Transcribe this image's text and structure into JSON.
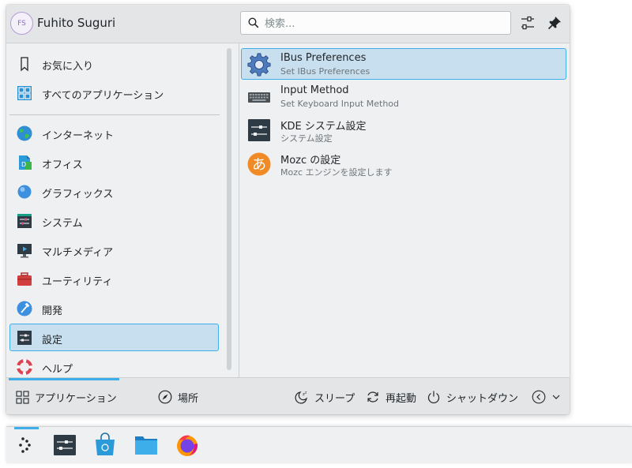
{
  "header": {
    "avatar_initials": "FS",
    "username": "Fuhito Suguri",
    "search_placeholder": "検索...",
    "configure_icon": "sliders-icon",
    "pin_icon": "pin-icon"
  },
  "sidebar": {
    "items": [
      {
        "label": "お気に入り",
        "icon": "bookmark-icon"
      },
      {
        "label": "すべてのアプリケーション",
        "icon": "grid-icon"
      },
      {
        "label": "インターネット",
        "icon": "globe-icon"
      },
      {
        "label": "オフィス",
        "icon": "office-icon"
      },
      {
        "label": "グラフィックス",
        "icon": "graphics-icon"
      },
      {
        "label": "システム",
        "icon": "system-icon"
      },
      {
        "label": "マルチメディア",
        "icon": "multimedia-icon"
      },
      {
        "label": "ユーティリティ",
        "icon": "toolbox-icon"
      },
      {
        "label": "開発",
        "icon": "hammer-icon"
      },
      {
        "label": "設定",
        "icon": "settings-icon",
        "selected": true
      },
      {
        "label": "ヘルプ",
        "icon": "lifebuoy-icon"
      }
    ]
  },
  "results": {
    "items": [
      {
        "name": "IBus Preferences",
        "desc": "Set IBus Preferences",
        "icon": "gear-icon",
        "selected": true
      },
      {
        "name": "Input Method",
        "desc": "Set Keyboard Input Method",
        "icon": "keyboard-icon"
      },
      {
        "name": "KDE システム設定",
        "desc": "システム設定",
        "icon": "system-settings-icon"
      },
      {
        "name": "Mozc の設定",
        "desc": "Mozc エンジンを設定します",
        "icon": "mozc-icon",
        "glyph": "あ"
      }
    ]
  },
  "footer": {
    "applications": "アプリケーション",
    "places": "場所",
    "sleep": "スリープ",
    "restart": "再起動",
    "shutdown": "シャットダウン"
  },
  "taskbar": {
    "items": [
      "launcher-icon",
      "system-settings-icon",
      "discover-icon",
      "file-manager-icon",
      "firefox-icon"
    ]
  },
  "colors": {
    "accent": "#3daee9",
    "selection": "#c7dfee",
    "background": "#eff0f1"
  }
}
